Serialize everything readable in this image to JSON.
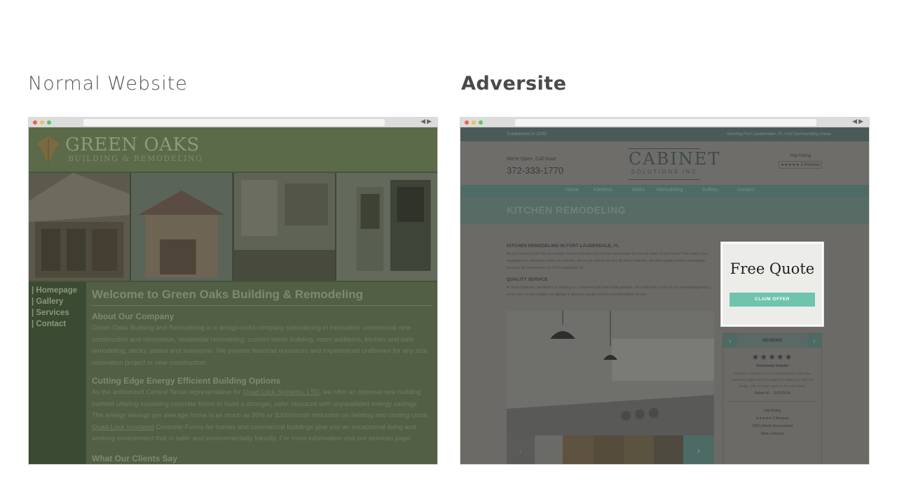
{
  "headings": {
    "left": "Normal Website",
    "right": "Adversite"
  },
  "left_site": {
    "logo_main": "GREEN OAKS",
    "logo_sub": "BUILDING & REMODELING",
    "nav": [
      "| Homepage",
      "| Gallery",
      "| Services",
      "| Contact"
    ],
    "title": "Welcome to Green Oaks Building & Remodeling",
    "about_heading": "About Our Company",
    "about_text": "Green Oaks Building and Remodeling is a design-build company specializing in innovative commercial new construction and renovation, residential remodeling, custom home building, room additions, kitchen and bath remodeling, decks, patios and sunrooms. We provide financial resources and experienced craftsmen for any size renovation project or new construction.",
    "energy_heading": "Cutting Edge Energy Efficient Building Options",
    "energy_text_1": "As the authorized Central Texas representative for ",
    "energy_link_1": "Quad Lock Systems, LTD",
    "energy_text_2": ", we offer an optional new building method utilizing insulating concrete forms to build a stronger, safer structure with unparalleled energy savings. The energy savings per average home is as much as 80% or $200/month reduction on heating and cooling costs. ",
    "energy_link_2": "Quad-Lock Insulated",
    "energy_text_3": " Concrete Forms for homes and commercial buildings give you an exceptional living and working environment that is safer and environmentally friendly. For more information visit our services page.",
    "clients_heading": "What Our Clients Say"
  },
  "right_site": {
    "topbar_left": "Established in 2000",
    "topbar_right": "Serving Fort Lauderdale, FL And Surrounding Areas",
    "open_text": "We're Open, Call Now!",
    "phone": "372-333-1770",
    "logo_main": "CABINET",
    "logo_sub": "SOLUTIONS INC",
    "rating_label": "Yelp Rating",
    "rating_stars": "★★★★★",
    "rating_count": "3 Reviews",
    "nav": [
      "Home",
      "Kitchens",
      "Baths",
      "Remodeling",
      "Gallery",
      "Contact"
    ],
    "banner_title": "KITCHEN REMODELING",
    "section1_heading": "KITCHEN REMODELING IN FORT LAUDERDALE, FL",
    "section1_text": "Do you love to cook? Do you simply want to remodel your kitchen to increase the overall value of your home? No matter your motivation for wanting to redo your kitchen, we've got options for you. At Rock Cabinets, we offer quality kitchen remodeling services for homeowners in Fort Lauderdale, FL.",
    "section2_heading": "QUALITY SERVICE",
    "section2_text": "At Rock Cabinets, we believe in offering our customers the best value possible. No matter the scope of your remodeling project or the size of your budget, we pledge to give you quality on-time and affordable service.",
    "reviews_heading": "REVIEWS",
    "review_stars": "★★★★★",
    "review_title": "Extremely helpful",
    "review_body": "Needed a new kitchen as a rental property. Who was extremely helpful and very patient in helping me with the design. Will use them again in the near future.",
    "review_author": "Robert M. - 11/03/2018",
    "footer_rating_label": "Yelp Rating",
    "footer_rating_count": "3 Reviews",
    "footer_recommend": "100% Would Recommend",
    "footer_link": "Write a Review",
    "popup_title": "Free Quote",
    "popup_button": "CLAIM OFFER"
  }
}
